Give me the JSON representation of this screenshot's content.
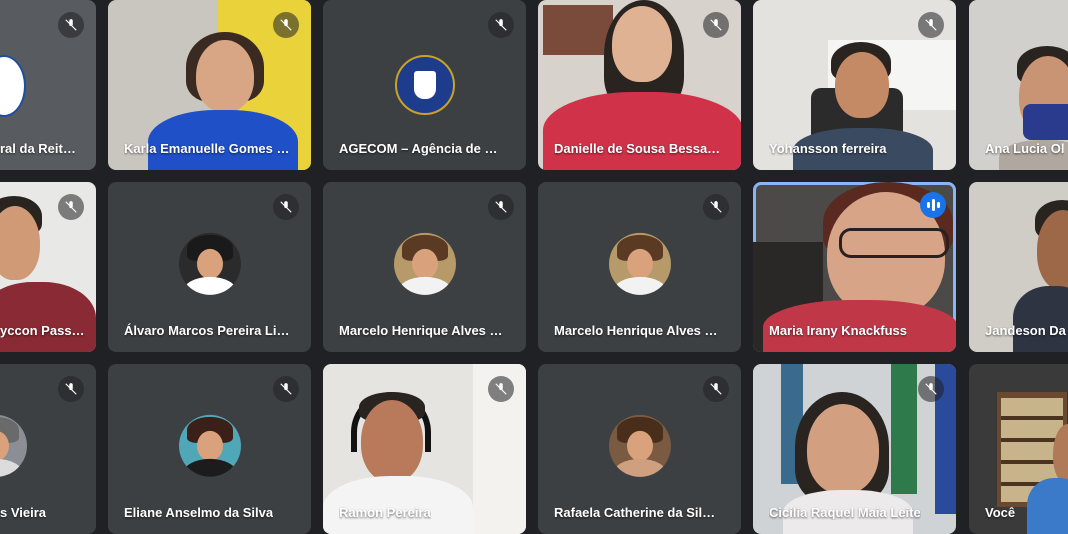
{
  "participants": [
    {
      "name": "ral da Reit…"
    },
    {
      "name": "Karla Emanuelle Gomes …"
    },
    {
      "name": "AGECOM – Agência de …"
    },
    {
      "name": "Danielle de Sousa Bessa…"
    },
    {
      "name": "Yohansson ferreira"
    },
    {
      "name": "Ana Lucia Ol"
    },
    {
      "name": "yccon Pass…"
    },
    {
      "name": "Álvaro Marcos Pereira Li…"
    },
    {
      "name": "Marcelo Henrique Alves …"
    },
    {
      "name": "Marcelo Henrique Alves …"
    },
    {
      "name": "Maria Irany Knackfuss"
    },
    {
      "name": "Jandeson Da"
    },
    {
      "name": "s Vieira"
    },
    {
      "name": "Eliane Anselmo da Silva"
    },
    {
      "name": "Ramon Pereira"
    },
    {
      "name": "Rafaela Catherine da Sil…"
    },
    {
      "name": "Cicilia Raquel Maia Leite"
    },
    {
      "name": "Você"
    }
  ],
  "colors": {
    "background": "#202124",
    "tile": "#3c4043",
    "speaking_outline": "#8ab4f8",
    "speaking_badge": "#1a73e8"
  },
  "icons": {
    "muted": "mic-off-icon",
    "speaking": "audio-level-icon"
  }
}
